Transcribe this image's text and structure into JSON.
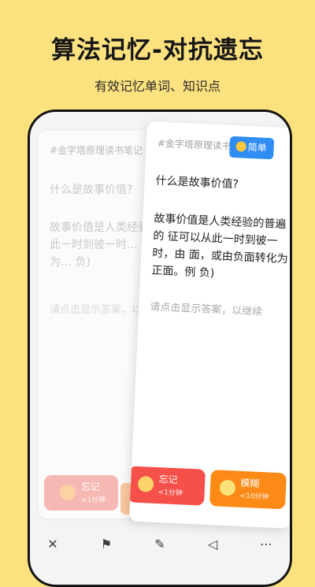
{
  "header": {
    "title": "算法记忆-对抗遗忘",
    "subtitle": "有效记忆单词、知识点"
  },
  "back_card": {
    "tag": "#金字塔原理读书笔记",
    "question": "什么是故事价值?",
    "answer": "故事价值是人类经验的普遍… 征可以从此一时到彼一时… 面，或由负面转化为… 负)",
    "hint": "请点击显示答案，以…",
    "forget_button": {
      "label": "忘记",
      "sub": "<1分钟"
    }
  },
  "front_card": {
    "tag": "#金字塔原理读书",
    "badge": "简单",
    "question": "什么是故事价值?",
    "answer": "故事价值是人类经验的普遍的 征可以从此一时到彼一时，由 面，或由负面转化为正面。例 负)",
    "hint": "请点击显示答案，以继续",
    "forget_button": {
      "label": "忘记",
      "sub": "<1分钟"
    },
    "vague_button": {
      "label": "模糊",
      "sub": "<10分钟"
    }
  },
  "bottom_bar": {
    "icons": [
      "close-icon",
      "flag-icon",
      "pencil-icon",
      "speaker-icon",
      "more-icon"
    ],
    "glyphs": {
      "close": "✕",
      "flag": "⚑",
      "pencil": "✎",
      "speaker": "◁",
      "more": "⋯"
    }
  },
  "colors": {
    "background": "#fce27f",
    "forget": "#f55049",
    "vague": "#fb8a17",
    "badge": "#2f8df4"
  }
}
